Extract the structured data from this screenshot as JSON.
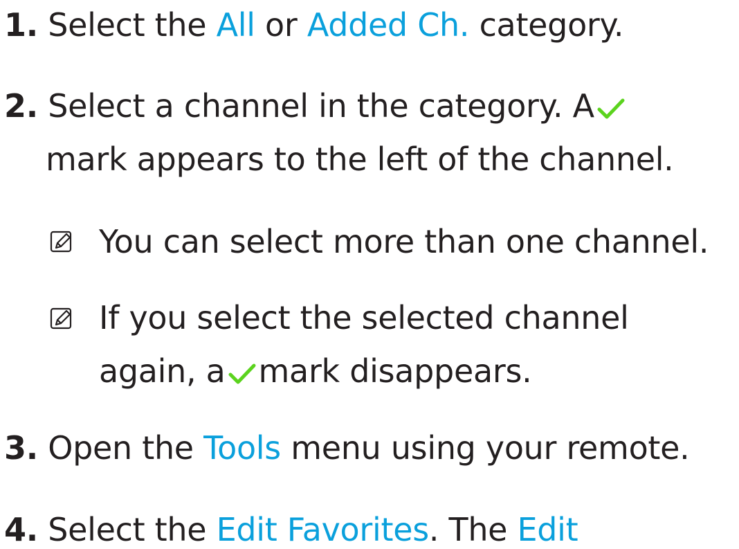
{
  "steps": {
    "step1": {
      "number": "1.",
      "pre": "Select the",
      "link_all": "All",
      "mid": "or",
      "link_added": "Added Ch.",
      "post": "category."
    },
    "step2": {
      "number": "2.",
      "line1": "Select a channel in the category. A",
      "line2": "mark appears to the left of the channel."
    },
    "step3": {
      "number": "3.",
      "pre": "Open the",
      "link_tools": "Tools",
      "post": "menu using your remote."
    },
    "step4": {
      "number": "4.",
      "pre": "Select the",
      "link_edit_favorites": "Edit Favorites",
      "mid": ". The",
      "link_edit": "Edit"
    }
  },
  "notes": {
    "note1": "You can select more than one channel.",
    "note2_line1": "If you select the selected channel",
    "note2_line2_pre": "again, a",
    "note2_line2_post": "mark disappears."
  },
  "colors": {
    "text": "#231f20",
    "highlight": "#0aa0dc",
    "check": "#5bd31e"
  },
  "icons": {
    "note": "memo-pencil-icon",
    "check": "check-mark-icon"
  }
}
